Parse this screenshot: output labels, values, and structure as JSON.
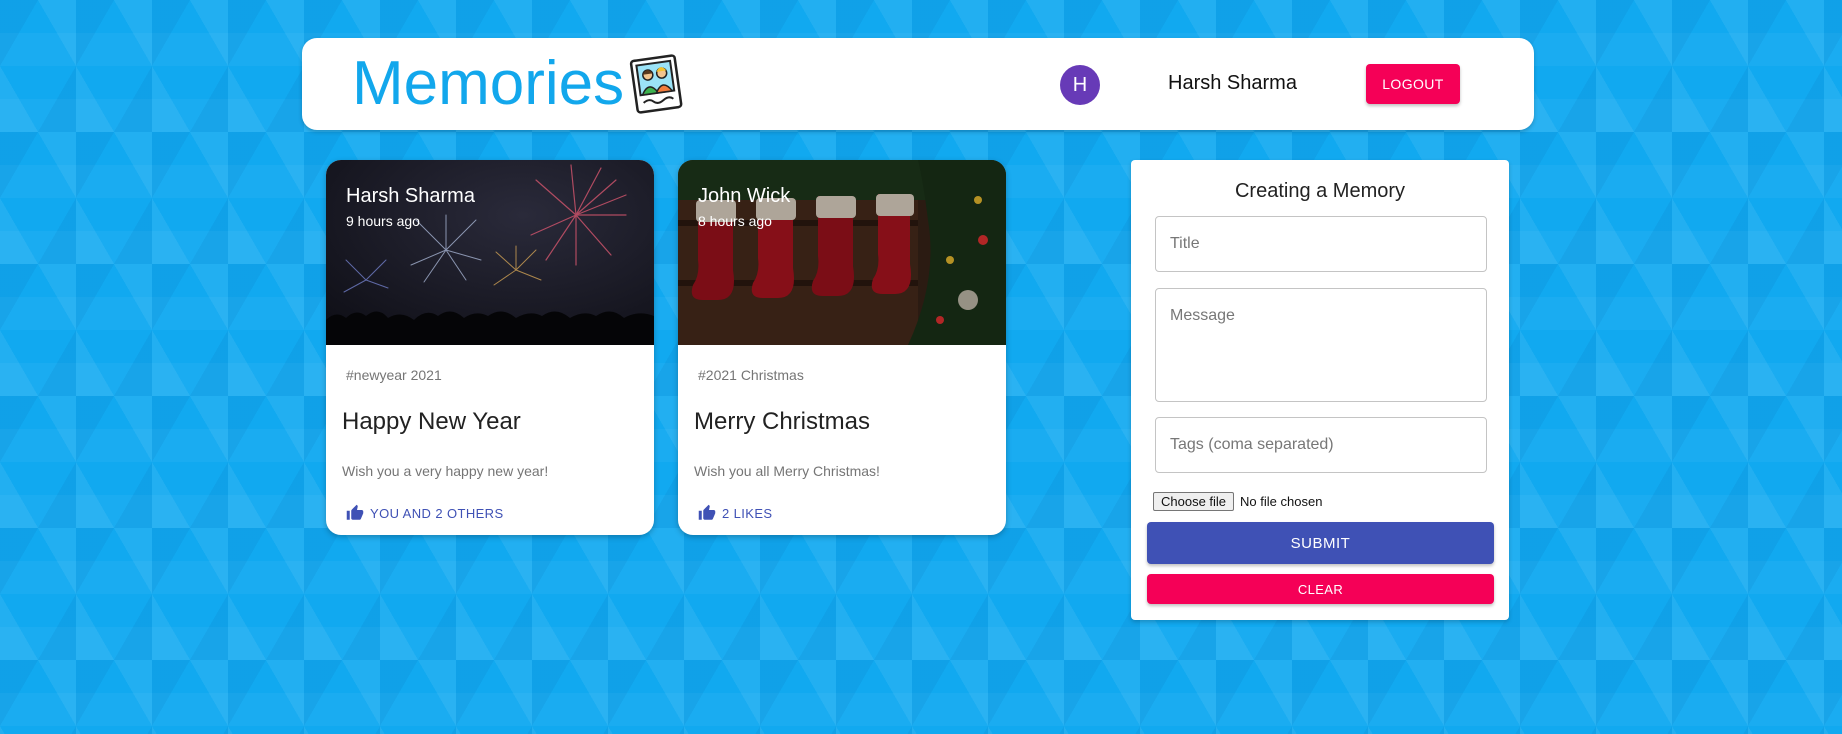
{
  "header": {
    "brand": "Memories",
    "logo_icon": "photo-memories-icon",
    "avatar_initial": "H",
    "user_name": "Harsh Sharma",
    "logout_label": "LOGOUT"
  },
  "posts": [
    {
      "author": "Harsh Sharma",
      "time": "9 hours ago",
      "image": "fireworks",
      "tags": "#newyear 2021",
      "title": "Happy New Year",
      "message": "Wish you a very happy new year!",
      "likes": "YOU AND 2 OTHERS"
    },
    {
      "author": "John Wick",
      "time": "8 hours ago",
      "image": "christmas-stockings",
      "tags": "#2021 Christmas",
      "title": "Merry Christmas",
      "message": "Wish you all Merry Christmas!",
      "likes": "2 LIKES"
    }
  ],
  "form": {
    "heading": "Creating a Memory",
    "title_placeholder": "Title",
    "message_placeholder": "Message",
    "tags_placeholder": "Tags (coma separated)",
    "file_button": "Choose file",
    "file_status": "No file chosen",
    "submit_label": "SUBMIT",
    "clear_label": "CLEAR"
  },
  "colors": {
    "background": "#11a9f0",
    "brand": "#12a7ec",
    "primary": "#3f51b5",
    "secondary": "#f50057",
    "avatar": "#673ab7"
  }
}
